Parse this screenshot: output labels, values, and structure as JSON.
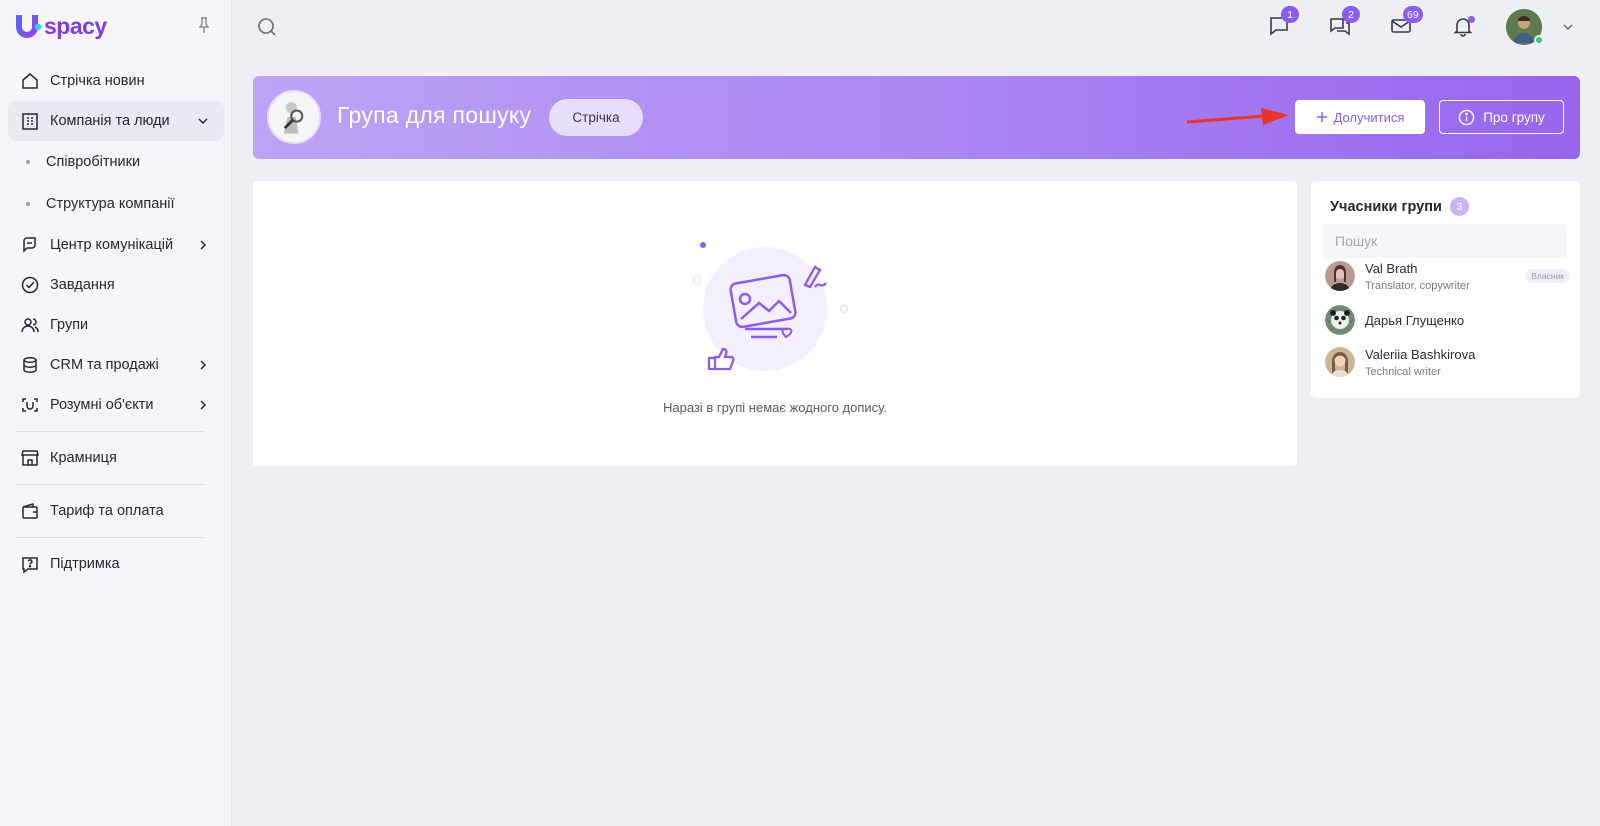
{
  "app": {
    "logo_text": "spacy",
    "brand_color": "#7b3fe4",
    "accent_color": "#8a5cf0"
  },
  "sidebar": {
    "items": [
      {
        "label": "Стрічка новин",
        "icon": "home-icon"
      },
      {
        "label": "Компанія та люди",
        "icon": "building-icon",
        "expanded": true
      },
      {
        "label": "Співробітники"
      },
      {
        "label": "Структура компанії"
      },
      {
        "label": "Центр комунікацій",
        "icon": "communication-icon"
      },
      {
        "label": "Завдання",
        "icon": "check-circle-icon"
      },
      {
        "label": "Групи",
        "icon": "users-icon"
      },
      {
        "label": "CRM та продажі",
        "icon": "database-icon"
      },
      {
        "label": "Розумні об'єкти",
        "icon": "smart-object-icon"
      },
      {
        "label": "Крамниця",
        "icon": "store-icon"
      },
      {
        "label": "Тариф та оплата",
        "icon": "wallet-icon"
      },
      {
        "label": "Підтримка",
        "icon": "help-icon"
      }
    ]
  },
  "topbar": {
    "chat_badge": "1",
    "messages_badge": "2",
    "mail_badge": "69",
    "online_color": "#2ecc71"
  },
  "group": {
    "title": "Група для пошуку",
    "tab_feed": "Стрічка",
    "join_label": "Долучитися",
    "about_label": "Про групу"
  },
  "feed": {
    "empty_text": "Наразі в групі немає жодного допису."
  },
  "members": {
    "title": "Учасники групи",
    "count": "3",
    "search_placeholder": "Пошук",
    "list": [
      {
        "name": "Val Brath",
        "role": "Translator, copywriter",
        "badge": "Власник"
      },
      {
        "name": "Дарья Глущенко",
        "role": "",
        "badge": ""
      },
      {
        "name": "Valeriia Bashkirova",
        "role": "Technical writer",
        "badge": ""
      }
    ]
  }
}
